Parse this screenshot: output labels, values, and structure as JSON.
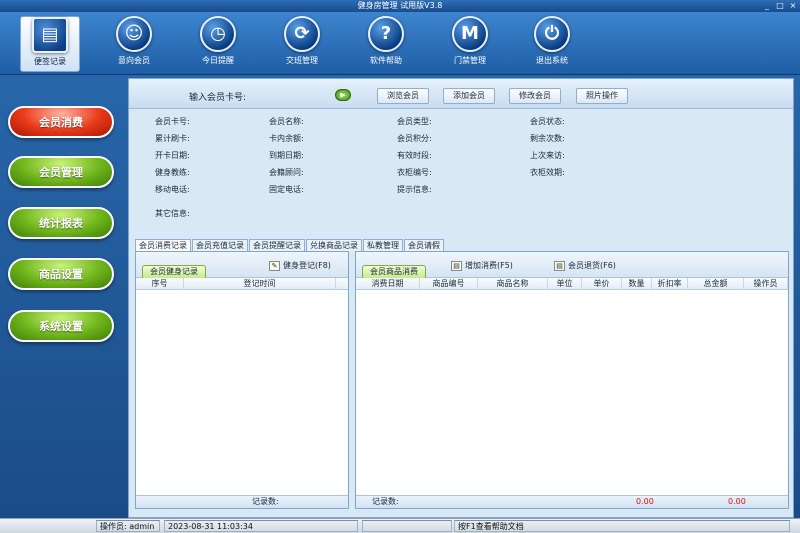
{
  "window": {
    "title": "健身房管理 试用版V3.8",
    "min": "_",
    "max": "□",
    "close": "×"
  },
  "toolbar": [
    {
      "label": "便签记录",
      "icon": "notepad-icon",
      "glyph": "▤",
      "active": true
    },
    {
      "label": "意向会员",
      "icon": "person-icon",
      "glyph": "☺",
      "active": false
    },
    {
      "label": "今日提醒",
      "icon": "clock-icon",
      "glyph": "◷",
      "active": false
    },
    {
      "label": "交班管理",
      "icon": "refresh-icon",
      "glyph": "⟳",
      "active": false
    },
    {
      "label": "软件帮助",
      "icon": "help-icon",
      "glyph": "?",
      "active": false
    },
    {
      "label": "门禁管理",
      "icon": "m-icon",
      "glyph": "M",
      "active": false
    },
    {
      "label": "退出系统",
      "icon": "power-icon",
      "glyph": "⏻",
      "active": false
    }
  ],
  "leftnav": [
    {
      "label": "会员消费",
      "style": "red"
    },
    {
      "label": "会员管理",
      "style": "green"
    },
    {
      "label": "统计报表",
      "style": "green"
    },
    {
      "label": "商品设置",
      "style": "green"
    },
    {
      "label": "系统设置",
      "style": "green"
    }
  ],
  "topbar": {
    "card_label": "输入会员卡号:",
    "play_glyph": "▶",
    "buttons": [
      "浏览会员",
      "添加会员",
      "修改会员",
      "照片操作"
    ]
  },
  "info": {
    "col1": [
      "会员卡号:",
      "累计刷卡:",
      "开卡日期:",
      "健身教练:",
      "移动电话:"
    ],
    "col2": [
      "会员名称:",
      "卡内余额:",
      "到期日期:",
      "会籍顾问:",
      "固定电话:"
    ],
    "col3": [
      "会员类型:",
      "会员积分:",
      "有效时段:",
      "衣柜编号:",
      "提示信息:"
    ],
    "col4": [
      "会员状态:",
      "剩余次数:",
      "上次来访:",
      "衣柜效期:"
    ],
    "other": "其它信息:"
  },
  "tabs": [
    "会员消费记录",
    "会员充值记录",
    "会员提醒记录",
    "兑换商品记录",
    "私教管理",
    "会员请假"
  ],
  "left_panel": {
    "tab": "会员健身记录",
    "action": "健身登记(F8)",
    "action_icon": "✎",
    "columns": [
      "序号",
      "登记时间"
    ],
    "footer": "记录数:"
  },
  "right_panel": {
    "tab": "会员商品消费",
    "actions": [
      {
        "label": "增加消费(F5)",
        "icon": "▤"
      },
      {
        "label": "会员退货(F6)",
        "icon": "▤"
      }
    ],
    "columns": [
      "消费日期",
      "商品编号",
      "商品名称",
      "单位",
      "单价",
      "数量",
      "折扣率",
      "总金额",
      "操作员"
    ],
    "footer": "记录数:",
    "sum1": "0.00",
    "sum2": "0.00"
  },
  "status": {
    "operator_label": "操作员:",
    "operator": "admin",
    "datetime": "2023-08-31 11:03:34",
    "help": "按F1查看帮助文档"
  }
}
